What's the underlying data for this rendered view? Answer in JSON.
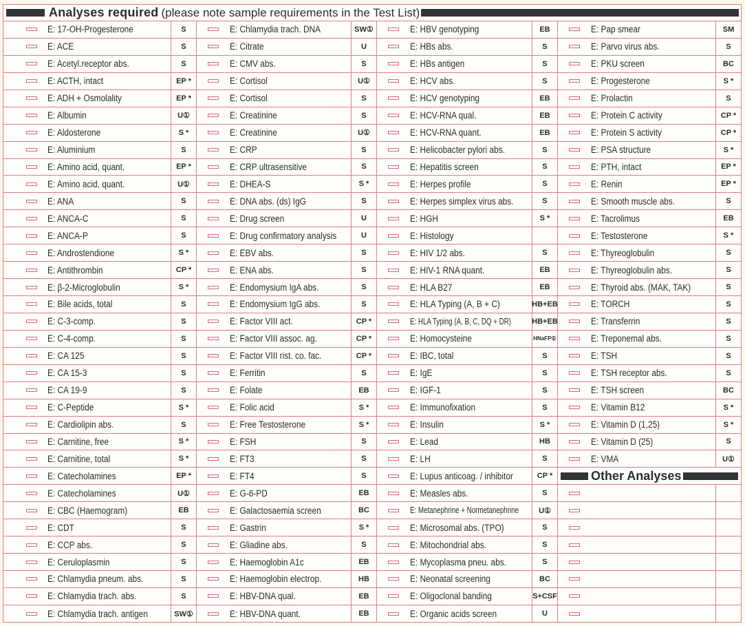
{
  "header": {
    "title": "Analyses required",
    "note": "(please note sample requirements in the Test List)"
  },
  "columns": [
    {
      "items": [
        {
          "name": "E: 17-OH-Progesterone",
          "code": "S"
        },
        {
          "name": "E: ACE",
          "code": "S"
        },
        {
          "name": "E: Acetyl.receptor abs.",
          "code": "S"
        },
        {
          "name": "E: ACTH, intact",
          "code": "EP *"
        },
        {
          "name": "E: ADH + Osmolality",
          "code": "EP *"
        },
        {
          "name": "E: Albumin",
          "code": "U①"
        },
        {
          "name": "E: Aldosterone",
          "code": "S *"
        },
        {
          "name": "E: Aluminium",
          "code": "S"
        },
        {
          "name": "E: Amino acid, quant.",
          "code": "EP *"
        },
        {
          "name": "E: Amino acid, quant.",
          "code": "U①"
        },
        {
          "name": "E: ANA",
          "code": "S"
        },
        {
          "name": "E: ANCA-C",
          "code": "S"
        },
        {
          "name": "E: ANCA-P",
          "code": "S"
        },
        {
          "name": "E: Androstendione",
          "code": "S *"
        },
        {
          "name": "E: Antithrombin",
          "code": "CP *"
        },
        {
          "name": "E: β-2-Microglobulin",
          "code": "S *"
        },
        {
          "name": "E: Bile acids, total",
          "code": "S"
        },
        {
          "name": "E: C-3-comp.",
          "code": "S"
        },
        {
          "name": "E: C-4-comp.",
          "code": "S"
        },
        {
          "name": "E: CA 125",
          "code": "S"
        },
        {
          "name": "E: CA 15-3",
          "code": "S"
        },
        {
          "name": "E: CA 19-9",
          "code": "S"
        },
        {
          "name": "E: C-Peptide",
          "code": "S *"
        },
        {
          "name": "E: Cardiolipin abs.",
          "code": "S"
        },
        {
          "name": "E: Carnitine, free",
          "code": "S *"
        },
        {
          "name": "E: Carnitine, total",
          "code": "S *"
        },
        {
          "name": "E: Catecholamines",
          "code": "EP *"
        },
        {
          "name": "E: Catecholamines",
          "code": "U①"
        },
        {
          "name": "E: CBC (Haemogram)",
          "code": "EB"
        },
        {
          "name": "E: CDT",
          "code": "S"
        },
        {
          "name": "E: CCP abs.",
          "code": "S"
        },
        {
          "name": "E: Ceruloplasmin",
          "code": "S"
        },
        {
          "name": "E: Chlamydia pneum. abs.",
          "code": "S"
        },
        {
          "name": "E: Chlamydia trach. abs.",
          "code": "S"
        },
        {
          "name": "E: Chlamydia trach. antigen",
          "code": "SW①"
        }
      ]
    },
    {
      "items": [
        {
          "name": "E: Chlamydia trach. DNA",
          "code": "SW①"
        },
        {
          "name": "E: Citrate",
          "code": "U"
        },
        {
          "name": "E: CMV abs.",
          "code": "S"
        },
        {
          "name": "E: Cortisol",
          "code": "U①"
        },
        {
          "name": "E: Cortisol",
          "code": "S"
        },
        {
          "name": "E: Creatinine",
          "code": "S"
        },
        {
          "name": "E: Creatinine",
          "code": "U①"
        },
        {
          "name": "E: CRP",
          "code": "S"
        },
        {
          "name": "E: CRP ultrasensitive",
          "code": "S"
        },
        {
          "name": "E: DHEA-S",
          "code": "S *"
        },
        {
          "name": "E: DNA abs. (ds) IgG",
          "code": "S"
        },
        {
          "name": "E: Drug screen",
          "code": "U"
        },
        {
          "name": "E: Drug confirmatory analysis",
          "code": "U"
        },
        {
          "name": "E: EBV abs.",
          "code": "S"
        },
        {
          "name": "E: ENA abs.",
          "code": "S"
        },
        {
          "name": "E: Endomysium IgA abs.",
          "code": "S"
        },
        {
          "name": "E: Endomysium IgG abs.",
          "code": "S"
        },
        {
          "name": "E: Factor VIII act.",
          "code": "CP *"
        },
        {
          "name": "E: Factor VIII assoc. ag.",
          "code": "CP *"
        },
        {
          "name": "E: Factor VIII rist. co. fac.",
          "code": "CP *"
        },
        {
          "name": "E: Ferritin",
          "code": "S"
        },
        {
          "name": "E: Folate",
          "code": "EB"
        },
        {
          "name": "E: Folic acid",
          "code": "S *"
        },
        {
          "name": "E: Free Testosterone",
          "code": "S *"
        },
        {
          "name": "E: FSH",
          "code": "S"
        },
        {
          "name": "E: FT3",
          "code": "S"
        },
        {
          "name": "E: FT4",
          "code": "S"
        },
        {
          "name": "E: G-6-PD",
          "code": "EB"
        },
        {
          "name": "E: Galactosaemia screen",
          "code": "BC"
        },
        {
          "name": "E: Gastrin",
          "code": "S *"
        },
        {
          "name": "E: Gliadine abs.",
          "code": "S"
        },
        {
          "name": "E: Haemoglobin A1c",
          "code": "EB"
        },
        {
          "name": "E: Haemoglobin electrop.",
          "code": "HB"
        },
        {
          "name": "E: HBV-DNA qual.",
          "code": "EB"
        },
        {
          "name": "E: HBV-DNA quant.",
          "code": "EB"
        }
      ]
    },
    {
      "items": [
        {
          "name": "E: HBV genotyping",
          "code": "EB"
        },
        {
          "name": "E: HBs abs.",
          "code": "S"
        },
        {
          "name": "E: HBs antigen",
          "code": "S"
        },
        {
          "name": "E: HCV abs.",
          "code": "S"
        },
        {
          "name": "E: HCV genotyping",
          "code": "EB"
        },
        {
          "name": "E: HCV-RNA qual.",
          "code": "EB"
        },
        {
          "name": "E: HCV-RNA quant.",
          "code": "EB"
        },
        {
          "name": "E: Helicobacter pylori abs.",
          "code": "S"
        },
        {
          "name": "E: Hepatitis screen",
          "code": "S"
        },
        {
          "name": "E: Herpes profile",
          "code": "S"
        },
        {
          "name": "E: Herpes simplex virus abs.",
          "code": "S"
        },
        {
          "name": "E: HGH",
          "code": "S *"
        },
        {
          "name": "E: Histology",
          "code": ""
        },
        {
          "name": "E: HIV 1/2 abs.",
          "code": "S"
        },
        {
          "name": "E: HIV-1 RNA quant.",
          "code": "EB"
        },
        {
          "name": "E: HLA B27",
          "code": "EB"
        },
        {
          "name": "E: HLA Typing (A, B + C)",
          "code": "HB+EB"
        },
        {
          "name": "E: HLA Typing (A, B, C, DQ + DR)",
          "code": "HB+EB"
        },
        {
          "name": "E: Homocysteine",
          "code": "HNaFP①"
        },
        {
          "name": "E: IBC, total",
          "code": "S"
        },
        {
          "name": "E: IgE",
          "code": "S"
        },
        {
          "name": "E: IGF-1",
          "code": "S"
        },
        {
          "name": "E: Immunofixation",
          "code": "S"
        },
        {
          "name": "E: Insulin",
          "code": "S *"
        },
        {
          "name": "E: Lead",
          "code": "HB"
        },
        {
          "name": "E: LH",
          "code": "S"
        },
        {
          "name": "E: Lupus anticoag. / inhibitor",
          "code": "CP *"
        },
        {
          "name": "E: Measles abs.",
          "code": "S"
        },
        {
          "name": "E: Metanephrine + Normetanephrine",
          "code": "U①"
        },
        {
          "name": "E: Microsomal abs. (TPO)",
          "code": "S"
        },
        {
          "name": "E: Mitochondrial abs.",
          "code": "S"
        },
        {
          "name": "E: Mycoplasma pneu. abs.",
          "code": "S"
        },
        {
          "name": "E: Neonatal screening",
          "code": "BC"
        },
        {
          "name": "E: Oligoclonal banding",
          "code": "S+CSF"
        },
        {
          "name": "E: Organic acids screen",
          "code": "U"
        }
      ]
    },
    {
      "items": [
        {
          "name": "E: Pap smear",
          "code": "SM"
        },
        {
          "name": "E: Parvo virus abs.",
          "code": "S"
        },
        {
          "name": "E: PKU screen",
          "code": "BC"
        },
        {
          "name": "E: Progesterone",
          "code": "S *"
        },
        {
          "name": "E: Prolactin",
          "code": "S"
        },
        {
          "name": "E: Protein C activity",
          "code": "CP *"
        },
        {
          "name": "E: Protein S activity",
          "code": "CP *"
        },
        {
          "name": "E: PSA structure",
          "code": "S *"
        },
        {
          "name": "E: PTH, intact",
          "code": "EP *"
        },
        {
          "name": "E: Renin",
          "code": "EP *"
        },
        {
          "name": "E: Smooth muscle abs.",
          "code": "S"
        },
        {
          "name": "E: Tacrolimus",
          "code": "EB"
        },
        {
          "name": "E: Testosterone",
          "code": "S *"
        },
        {
          "name": "E: Thyreoglobulin",
          "code": "S"
        },
        {
          "name": "E: Thyreoglobulin abs.",
          "code": "S"
        },
        {
          "name": "E: Thyroid abs. (MAK, TAK)",
          "code": "S"
        },
        {
          "name": "E: TORCH",
          "code": "S"
        },
        {
          "name": "E: Transferrin",
          "code": "S"
        },
        {
          "name": "E: Treponemal abs.",
          "code": "S"
        },
        {
          "name": "E: TSH",
          "code": "S"
        },
        {
          "name": "E: TSH receptor abs.",
          "code": "S"
        },
        {
          "name": "E: TSH screen",
          "code": "BC"
        },
        {
          "name": "E: Vitamin B12",
          "code": "S *"
        },
        {
          "name": "E: Vitamin D (1,25)",
          "code": "S *"
        },
        {
          "name": "E: Vitamin D (25)",
          "code": "S"
        },
        {
          "name": "E: VMA",
          "code": "U①"
        }
      ],
      "other": {
        "title": "Other Analyses",
        "blank_rows": 8
      }
    }
  ]
}
